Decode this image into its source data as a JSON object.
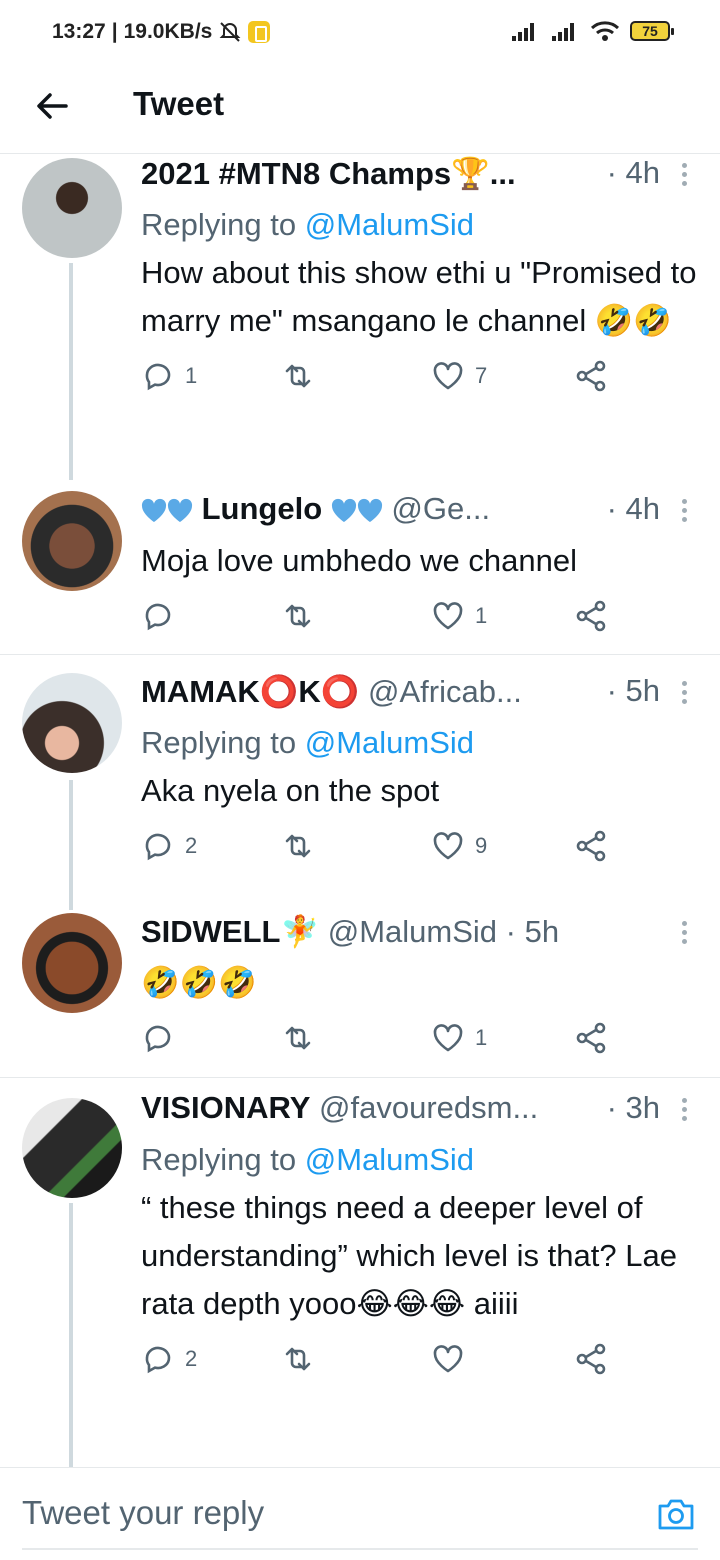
{
  "status_bar": {
    "time": "13:27",
    "speed": "19.0KB/s",
    "battery": "75"
  },
  "header": {
    "title": "Tweet"
  },
  "tweets": [
    {
      "name": "2021 #MTN8 Champs🏆...",
      "handle": "",
      "time": "· 4h",
      "replying_prefix": "Replying to ",
      "replying_to": "@MalumSid",
      "text": "How about this show ethi u \"Promised to marry me\" msangano le channel 🤣🤣",
      "replies": "1",
      "likes": "7"
    },
    {
      "name": "Lungelo",
      "handle": "@Ge...",
      "time": "· 4h",
      "text": "Moja love umbhedo we channel",
      "replies": "",
      "likes": "1"
    },
    {
      "name": "MAMAK⭕K⭕",
      "handle": "@Africab...",
      "time": "· 5h",
      "replying_prefix": "Replying to ",
      "replying_to": "@MalumSid",
      "text": "Aka nyela on the spot",
      "replies": "2",
      "likes": "9"
    },
    {
      "name": "SIDWELL🧚",
      "handle": "@MalumSid",
      "time": "· 5h",
      "text": "🤣🤣🤣",
      "replies": "",
      "likes": "1"
    },
    {
      "name": "VISIONARY",
      "handle": "@favouredsm...",
      "time": "· 3h",
      "replying_prefix": "Replying to ",
      "replying_to": "@MalumSid",
      "text": "“ these things need a deeper level of understanding” which level is that? Lae rata depth yooo😂😂😂 aiiii",
      "replies": "2",
      "likes": ""
    }
  ],
  "reply_box": {
    "placeholder": "Tweet your reply"
  },
  "colors": {
    "accent": "#1d9bf0",
    "muted": "#536471",
    "divider": "#e6e9eb"
  },
  "icons": [
    "back-arrow-icon",
    "reply-icon",
    "retweet-icon",
    "like-icon",
    "share-icon",
    "more-icon",
    "camera-icon",
    "blue-heart-icon"
  ]
}
